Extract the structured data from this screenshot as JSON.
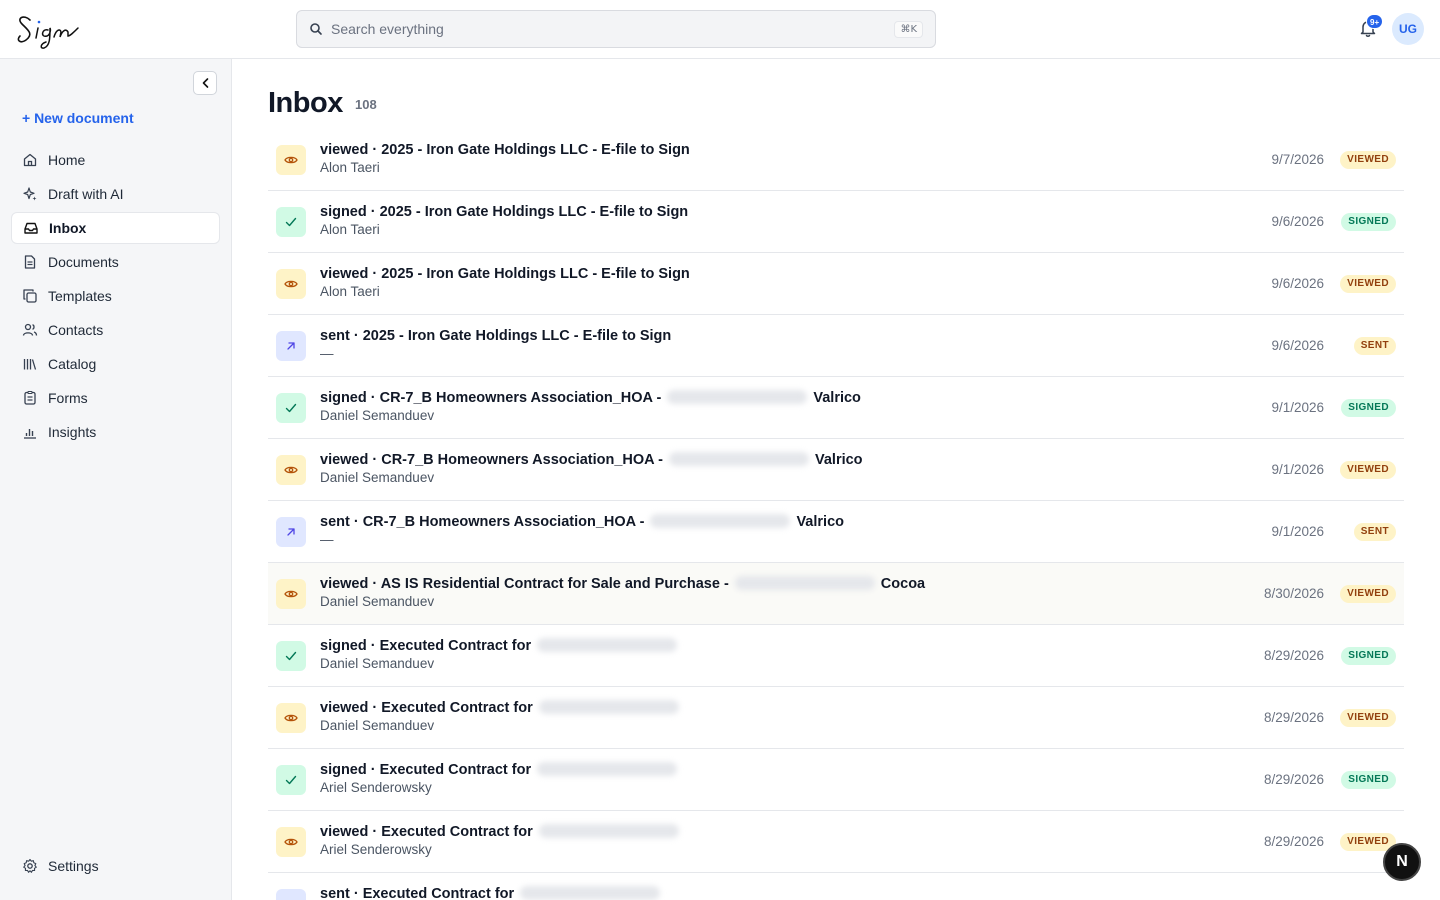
{
  "header": {
    "search_placeholder": "Search everything",
    "search_shortcut": "⌘K",
    "notif_count": "9+",
    "user_initials": "UG"
  },
  "sidebar": {
    "new_document": "+ New document",
    "items": [
      {
        "label": "Home",
        "icon": "home-icon"
      },
      {
        "label": "Draft with AI",
        "icon": "sparkle-icon"
      },
      {
        "label": "Inbox",
        "icon": "inbox-icon",
        "active": true
      },
      {
        "label": "Documents",
        "icon": "document-icon"
      },
      {
        "label": "Templates",
        "icon": "templates-icon"
      },
      {
        "label": "Contacts",
        "icon": "contacts-icon"
      },
      {
        "label": "Catalog",
        "icon": "catalog-icon"
      },
      {
        "label": "Forms",
        "icon": "forms-icon"
      },
      {
        "label": "Insights",
        "icon": "insights-icon"
      }
    ],
    "settings": "Settings"
  },
  "main": {
    "title": "Inbox",
    "count": "108",
    "rows": [
      {
        "status": "viewed",
        "title": "viewed · 2025 - Iron Gate Holdings LLC - E-file to Sign",
        "redacted": false,
        "suffix": "",
        "person": "Alon Taeri",
        "date": "9/7/2026",
        "badge": "VIEWED"
      },
      {
        "status": "signed",
        "title": "signed · 2025 - Iron Gate Holdings LLC - E-file to Sign",
        "redacted": false,
        "suffix": "",
        "person": "Alon Taeri",
        "date": "9/6/2026",
        "badge": "SIGNED"
      },
      {
        "status": "viewed",
        "title": "viewed · 2025 - Iron Gate Holdings LLC - E-file to Sign",
        "redacted": false,
        "suffix": "",
        "person": "Alon Taeri",
        "date": "9/6/2026",
        "badge": "VIEWED"
      },
      {
        "status": "sent",
        "title": "sent · 2025 - Iron Gate Holdings LLC - E-file to Sign",
        "redacted": false,
        "suffix": "",
        "person": "—",
        "date": "9/6/2026",
        "badge": "SENT"
      },
      {
        "status": "signed",
        "title": "signed · CR-7_B Homeowners Association_HOA -",
        "redacted": true,
        "suffix": "Valrico",
        "person": "Daniel Semanduev",
        "date": "9/1/2026",
        "badge": "SIGNED"
      },
      {
        "status": "viewed",
        "title": "viewed · CR-7_B Homeowners Association_HOA -",
        "redacted": true,
        "suffix": "Valrico",
        "person": "Daniel Semanduev",
        "date": "9/1/2026",
        "badge": "VIEWED"
      },
      {
        "status": "sent",
        "title": "sent · CR-7_B Homeowners Association_HOA -",
        "redacted": true,
        "suffix": "Valrico",
        "person": "—",
        "date": "9/1/2026",
        "badge": "SENT"
      },
      {
        "status": "viewed",
        "title": "viewed · AS IS Residential Contract for Sale and Purchase -",
        "redacted": true,
        "suffix": "Cocoa",
        "person": "Daniel Semanduev",
        "date": "8/30/2026",
        "badge": "VIEWED",
        "hover": true
      },
      {
        "status": "signed",
        "title": "signed · Executed Contract for",
        "redacted": true,
        "suffix": "",
        "person": "Daniel Semanduev",
        "date": "8/29/2026",
        "badge": "SIGNED"
      },
      {
        "status": "viewed",
        "title": "viewed · Executed Contract for",
        "redacted": true,
        "suffix": "",
        "person": "Daniel Semanduev",
        "date": "8/29/2026",
        "badge": "VIEWED"
      },
      {
        "status": "signed",
        "title": "signed · Executed Contract for",
        "redacted": true,
        "suffix": "",
        "person": "Ariel Senderowsky",
        "date": "8/29/2026",
        "badge": "SIGNED"
      },
      {
        "status": "viewed",
        "title": "viewed · Executed Contract for",
        "redacted": true,
        "suffix": "",
        "person": "Ariel Senderowsky",
        "date": "8/29/2026",
        "badge": "VIEWED"
      },
      {
        "status": "sent",
        "title": "sent · Executed Contract for",
        "redacted": true,
        "suffix": "",
        "person": "",
        "date": "",
        "badge": ""
      }
    ]
  },
  "fab_label": "N"
}
